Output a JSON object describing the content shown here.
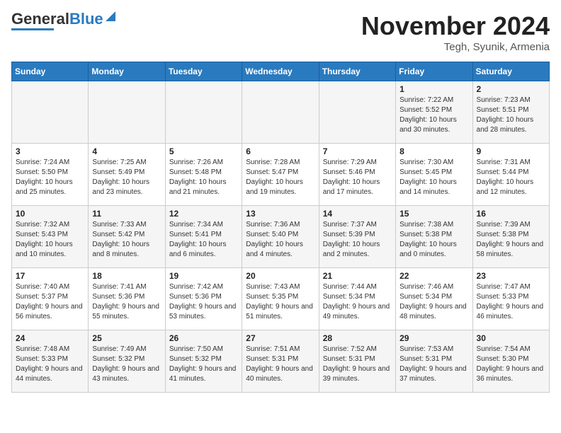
{
  "header": {
    "logo_general": "General",
    "logo_blue": "Blue",
    "month_title": "November 2024",
    "location": "Tegh, Syunik, Armenia"
  },
  "weekdays": [
    "Sunday",
    "Monday",
    "Tuesday",
    "Wednesday",
    "Thursday",
    "Friday",
    "Saturday"
  ],
  "weeks": [
    [
      {
        "day": "",
        "info": ""
      },
      {
        "day": "",
        "info": ""
      },
      {
        "day": "",
        "info": ""
      },
      {
        "day": "",
        "info": ""
      },
      {
        "day": "",
        "info": ""
      },
      {
        "day": "1",
        "info": "Sunrise: 7:22 AM\nSunset: 5:52 PM\nDaylight: 10 hours and 30 minutes."
      },
      {
        "day": "2",
        "info": "Sunrise: 7:23 AM\nSunset: 5:51 PM\nDaylight: 10 hours and 28 minutes."
      }
    ],
    [
      {
        "day": "3",
        "info": "Sunrise: 7:24 AM\nSunset: 5:50 PM\nDaylight: 10 hours and 25 minutes."
      },
      {
        "day": "4",
        "info": "Sunrise: 7:25 AM\nSunset: 5:49 PM\nDaylight: 10 hours and 23 minutes."
      },
      {
        "day": "5",
        "info": "Sunrise: 7:26 AM\nSunset: 5:48 PM\nDaylight: 10 hours and 21 minutes."
      },
      {
        "day": "6",
        "info": "Sunrise: 7:28 AM\nSunset: 5:47 PM\nDaylight: 10 hours and 19 minutes."
      },
      {
        "day": "7",
        "info": "Sunrise: 7:29 AM\nSunset: 5:46 PM\nDaylight: 10 hours and 17 minutes."
      },
      {
        "day": "8",
        "info": "Sunrise: 7:30 AM\nSunset: 5:45 PM\nDaylight: 10 hours and 14 minutes."
      },
      {
        "day": "9",
        "info": "Sunrise: 7:31 AM\nSunset: 5:44 PM\nDaylight: 10 hours and 12 minutes."
      }
    ],
    [
      {
        "day": "10",
        "info": "Sunrise: 7:32 AM\nSunset: 5:43 PM\nDaylight: 10 hours and 10 minutes."
      },
      {
        "day": "11",
        "info": "Sunrise: 7:33 AM\nSunset: 5:42 PM\nDaylight: 10 hours and 8 minutes."
      },
      {
        "day": "12",
        "info": "Sunrise: 7:34 AM\nSunset: 5:41 PM\nDaylight: 10 hours and 6 minutes."
      },
      {
        "day": "13",
        "info": "Sunrise: 7:36 AM\nSunset: 5:40 PM\nDaylight: 10 hours and 4 minutes."
      },
      {
        "day": "14",
        "info": "Sunrise: 7:37 AM\nSunset: 5:39 PM\nDaylight: 10 hours and 2 minutes."
      },
      {
        "day": "15",
        "info": "Sunrise: 7:38 AM\nSunset: 5:38 PM\nDaylight: 10 hours and 0 minutes."
      },
      {
        "day": "16",
        "info": "Sunrise: 7:39 AM\nSunset: 5:38 PM\nDaylight: 9 hours and 58 minutes."
      }
    ],
    [
      {
        "day": "17",
        "info": "Sunrise: 7:40 AM\nSunset: 5:37 PM\nDaylight: 9 hours and 56 minutes."
      },
      {
        "day": "18",
        "info": "Sunrise: 7:41 AM\nSunset: 5:36 PM\nDaylight: 9 hours and 55 minutes."
      },
      {
        "day": "19",
        "info": "Sunrise: 7:42 AM\nSunset: 5:36 PM\nDaylight: 9 hours and 53 minutes."
      },
      {
        "day": "20",
        "info": "Sunrise: 7:43 AM\nSunset: 5:35 PM\nDaylight: 9 hours and 51 minutes."
      },
      {
        "day": "21",
        "info": "Sunrise: 7:44 AM\nSunset: 5:34 PM\nDaylight: 9 hours and 49 minutes."
      },
      {
        "day": "22",
        "info": "Sunrise: 7:46 AM\nSunset: 5:34 PM\nDaylight: 9 hours and 48 minutes."
      },
      {
        "day": "23",
        "info": "Sunrise: 7:47 AM\nSunset: 5:33 PM\nDaylight: 9 hours and 46 minutes."
      }
    ],
    [
      {
        "day": "24",
        "info": "Sunrise: 7:48 AM\nSunset: 5:33 PM\nDaylight: 9 hours and 44 minutes."
      },
      {
        "day": "25",
        "info": "Sunrise: 7:49 AM\nSunset: 5:32 PM\nDaylight: 9 hours and 43 minutes."
      },
      {
        "day": "26",
        "info": "Sunrise: 7:50 AM\nSunset: 5:32 PM\nDaylight: 9 hours and 41 minutes."
      },
      {
        "day": "27",
        "info": "Sunrise: 7:51 AM\nSunset: 5:31 PM\nDaylight: 9 hours and 40 minutes."
      },
      {
        "day": "28",
        "info": "Sunrise: 7:52 AM\nSunset: 5:31 PM\nDaylight: 9 hours and 39 minutes."
      },
      {
        "day": "29",
        "info": "Sunrise: 7:53 AM\nSunset: 5:31 PM\nDaylight: 9 hours and 37 minutes."
      },
      {
        "day": "30",
        "info": "Sunrise: 7:54 AM\nSunset: 5:30 PM\nDaylight: 9 hours and 36 minutes."
      }
    ]
  ]
}
